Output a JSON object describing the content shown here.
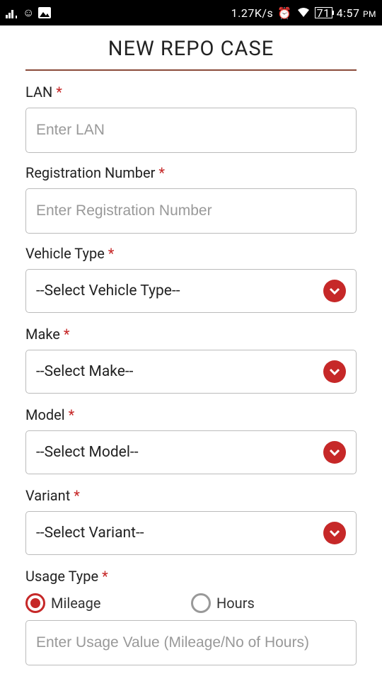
{
  "status": {
    "dataRate": "1.27K/s",
    "battery": "71",
    "time": "4:57",
    "ampm": "PM"
  },
  "page": {
    "title": "NEW REPO CASE"
  },
  "fields": {
    "lan": {
      "label": "LAN",
      "placeholder": "Enter LAN",
      "required": "*"
    },
    "regNum": {
      "label": "Registration Number",
      "placeholder": "Enter Registration Number",
      "required": "*"
    },
    "vehicleType": {
      "label": "Vehicle Type",
      "selected": "--Select Vehicle Type--",
      "required": "*"
    },
    "make": {
      "label": "Make",
      "selected": "--Select Make--",
      "required": "*"
    },
    "model": {
      "label": "Model",
      "selected": "--Select Model--",
      "required": "*"
    },
    "variant": {
      "label": "Variant",
      "selected": "--Select Variant--",
      "required": "*"
    },
    "usageType": {
      "label": "Usage Type",
      "required": "*",
      "option1": "Mileage",
      "option2": "Hours",
      "placeholder": "Enter Usage Value (Mileage/No of Hours)"
    }
  }
}
